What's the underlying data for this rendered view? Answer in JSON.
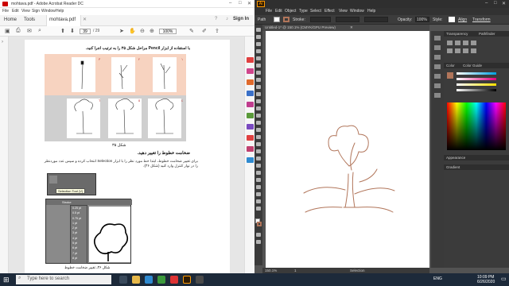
{
  "acrobat": {
    "window_title": "mohtava.pdf - Adobe Acrobat Reader DC",
    "menu": [
      "File",
      "Edit",
      "View",
      "Sign",
      "Window",
      "Help"
    ],
    "tabs": {
      "home": "Home",
      "tools": "Tools",
      "doc": "mohtava.pdf"
    },
    "sign_in": "Sign In",
    "page_current": "39",
    "page_total": "/ 29",
    "zoom": "100%",
    "doc": {
      "step_heading": "با استفاده از ابزار Pencil مراحل شکل ۳۵ را به ترتیب اجرا کنید.",
      "figure_caption": "شکل ۳۵",
      "section_heading": "ضخامت خطوط را تغییر دهید.",
      "paragraph": "برای تغییر ضخامت خطوط، ابتدا خط مورد نظر را با ابزار Selection انتخاب کرده و سپس عدد موردنظر را در نوار کنترل وارد کنید (شکل ۳۶).",
      "tooltip": "Selection Tool (V)",
      "stroke_label": "Stroke",
      "stroke_sizes": [
        "0.25 pt",
        "0.5 pt",
        "0.75 pt",
        "1 pt",
        "2 pt",
        "3 pt",
        "4 pt",
        "5 pt",
        "6 pt",
        "7 pt",
        "8 pt"
      ],
      "figure2_caption": "شکل ۳۶ـ تغییر ضخامت خطوط"
    }
  },
  "illustrator": {
    "menu": [
      "File",
      "Edit",
      "Object",
      "Type",
      "Select",
      "Effect",
      "View",
      "Window",
      "Help"
    ],
    "ctrl": {
      "path": "Path",
      "stroke": "Stroke:",
      "opacity": "Opacity:",
      "opacity_value": "100%",
      "style": "Style:",
      "align": "Align",
      "transform": "Transform"
    },
    "doc_tab": "Untitled-1* @ 150.1% (CMYK/GPU Preview)",
    "status_zoom": "150.1%",
    "status_page": "1",
    "status_tool": "Selection",
    "panels": {
      "gradient": "Gradient",
      "color": "Color",
      "color_guide": "Color Guide",
      "appearance": "Appearance",
      "pathfinder": "Pathfinder",
      "transparency": "Transparency"
    },
    "stroke_color": "#b1755a"
  },
  "taskbar": {
    "search_placeholder": "Type here to search",
    "time": "10:09 PM",
    "date": "6/26/2020",
    "lang": "ENG"
  }
}
